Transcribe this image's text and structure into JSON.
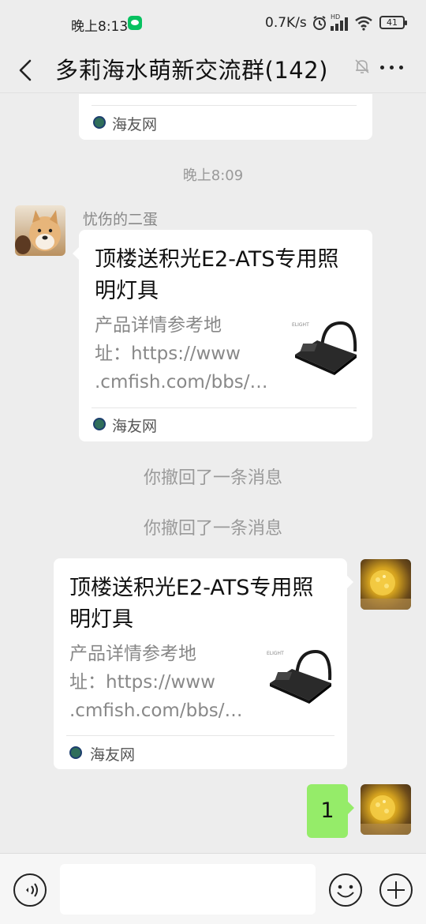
{
  "status_bar": {
    "time": "晚上8:13",
    "net_speed": "0.7K/s",
    "hd_label": "HD",
    "battery": "41"
  },
  "header": {
    "title": "多莉海水萌新交流群(142)"
  },
  "messages": {
    "top_card": {
      "source": "海友网"
    },
    "timestamp": "晚上8:09",
    "msg1": {
      "sender": "忧伤的二蛋",
      "title": "顶楼送积光E2-ATS专用照明灯具",
      "desc_lines": [
        "产品详情参考地",
        "址：https://www",
        ".cmfish.com/bbs/…"
      ],
      "source": "海友网"
    },
    "recall1": "你撤回了一条消息",
    "recall2": "你撤回了一条消息",
    "msg2": {
      "title": "顶楼送积光E2-ATS专用照明灯具",
      "desc_lines": [
        "产品详情参考地",
        "址：https://www",
        ".cmfish.com/bbs/…"
      ],
      "source": "海友网"
    },
    "msg3": {
      "text": "1"
    }
  },
  "input": {
    "placeholder": ""
  },
  "colors": {
    "background": "#ededed",
    "self_bubble": "#95ec69",
    "wechat_green": "#07c160"
  },
  "icons": [
    "back-arrow-icon",
    "mute-bell-icon",
    "more-dots-icon",
    "voice-icon",
    "emoji-icon",
    "plus-icon",
    "source-logo-icon",
    "lamp-thumbnail-icon"
  ]
}
